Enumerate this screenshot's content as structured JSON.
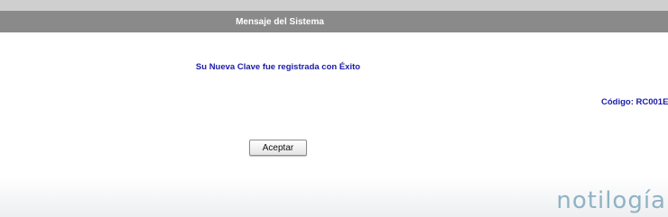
{
  "dialog": {
    "title": "Mensaje del Sistema",
    "message": "Su Nueva Clave fue registrada con Éxito",
    "code_label": "Código: RC001E"
  },
  "buttons": {
    "accept_label": "Aceptar"
  },
  "watermark": {
    "text": "notilogía"
  },
  "colors": {
    "title_bar": "#8a8a8a",
    "message_text": "#1a1aa8",
    "watermark": "#8fb3c4"
  }
}
